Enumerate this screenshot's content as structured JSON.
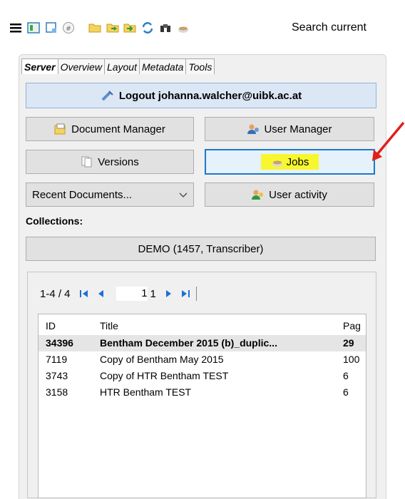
{
  "toolbar": {
    "search_text": "Search current",
    "icons": [
      "menu-icon",
      "layout-icon",
      "page-icon",
      "info-icon",
      "folder-icon",
      "export-icon",
      "import-icon",
      "refresh-icon",
      "binoculars-icon",
      "jobs-cup-icon"
    ]
  },
  "tabs": [
    {
      "label": "Server",
      "active": true
    },
    {
      "label": "Overview",
      "active": false
    },
    {
      "label": "Layout",
      "active": false
    },
    {
      "label": "Metadata",
      "active": false
    },
    {
      "label": "Tools",
      "active": false
    }
  ],
  "server": {
    "logout_label": "Logout johanna.walcher@uibk.ac.at",
    "document_manager_label": "Document Manager",
    "user_manager_label": "User Manager",
    "versions_label": "Versions",
    "jobs_label": "Jobs",
    "recent_documents_label": "Recent Documents...",
    "user_activity_label": "User activity",
    "collections_label": "Collections:",
    "collection_value": "DEMO (1457, Transcriber)"
  },
  "pager": {
    "range": "1-4 / 4",
    "page": "1",
    "total": "1"
  },
  "table": {
    "headers": {
      "id": "ID",
      "title": "Title",
      "pages": "Pag"
    },
    "rows": [
      {
        "id": "34396",
        "title": "Bentham December 2015 (b)_duplic...",
        "pages": "29"
      },
      {
        "id": "7119",
        "title": "Copy of Bentham May 2015",
        "pages": "100"
      },
      {
        "id": "3743",
        "title": "Copy of HTR Bentham TEST",
        "pages": "6"
      },
      {
        "id": "3158",
        "title": "HTR Bentham TEST",
        "pages": "6"
      }
    ]
  },
  "colors": {
    "accent": "#1979ca",
    "highlight": "#f7f72f",
    "annotation_arrow": "#e0201b"
  }
}
